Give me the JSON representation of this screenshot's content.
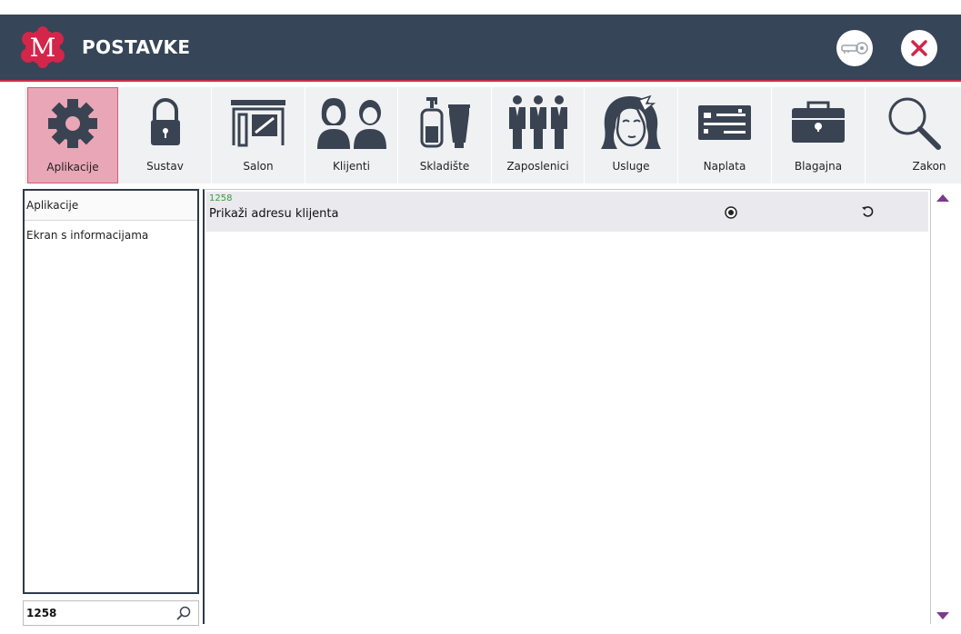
{
  "header": {
    "logo_letter": "M",
    "title": "POSTAVKE",
    "key_button": "key-icon",
    "close_button": "close-icon"
  },
  "toolbar": {
    "items": [
      {
        "label": "Aplikacije",
        "icon": "gear-icon",
        "active": true
      },
      {
        "label": "Sustav",
        "icon": "lock-icon"
      },
      {
        "label": "Salon",
        "icon": "salon-icon"
      },
      {
        "label": "Klijenti",
        "icon": "clients-icon"
      },
      {
        "label": "Skladište",
        "icon": "warehouse-products-icon"
      },
      {
        "label": "Zaposlenici",
        "icon": "employees-icon"
      },
      {
        "label": "Usluge",
        "icon": "services-woman-icon"
      },
      {
        "label": "Naplata",
        "icon": "payment-card-icon"
      },
      {
        "label": "Blagajna",
        "icon": "cash-register-icon"
      },
      {
        "label": "Zakon",
        "icon": "magnifier-icon"
      }
    ]
  },
  "left_panel": {
    "items": [
      "Aplikacije",
      "Ekran s informacijama"
    ],
    "search": {
      "value": "1258",
      "icon": "search-icon"
    }
  },
  "settings": {
    "rows": [
      {
        "id": "1258",
        "label": "Prikaži adresu klijenta",
        "radio_selected": true,
        "reset_icon": "reset-icon"
      }
    ]
  },
  "scrollbar": {
    "up": "scroll-up-arrow",
    "down": "scroll-down-arrow"
  },
  "colors": {
    "header_bg": "#364558",
    "accent": "#cf2d4a",
    "active_tab": "#e9a6b6",
    "icon_dark": "#3a4352",
    "scroll_arrow": "#7b3a8a",
    "id_green": "#3a9a3a"
  }
}
